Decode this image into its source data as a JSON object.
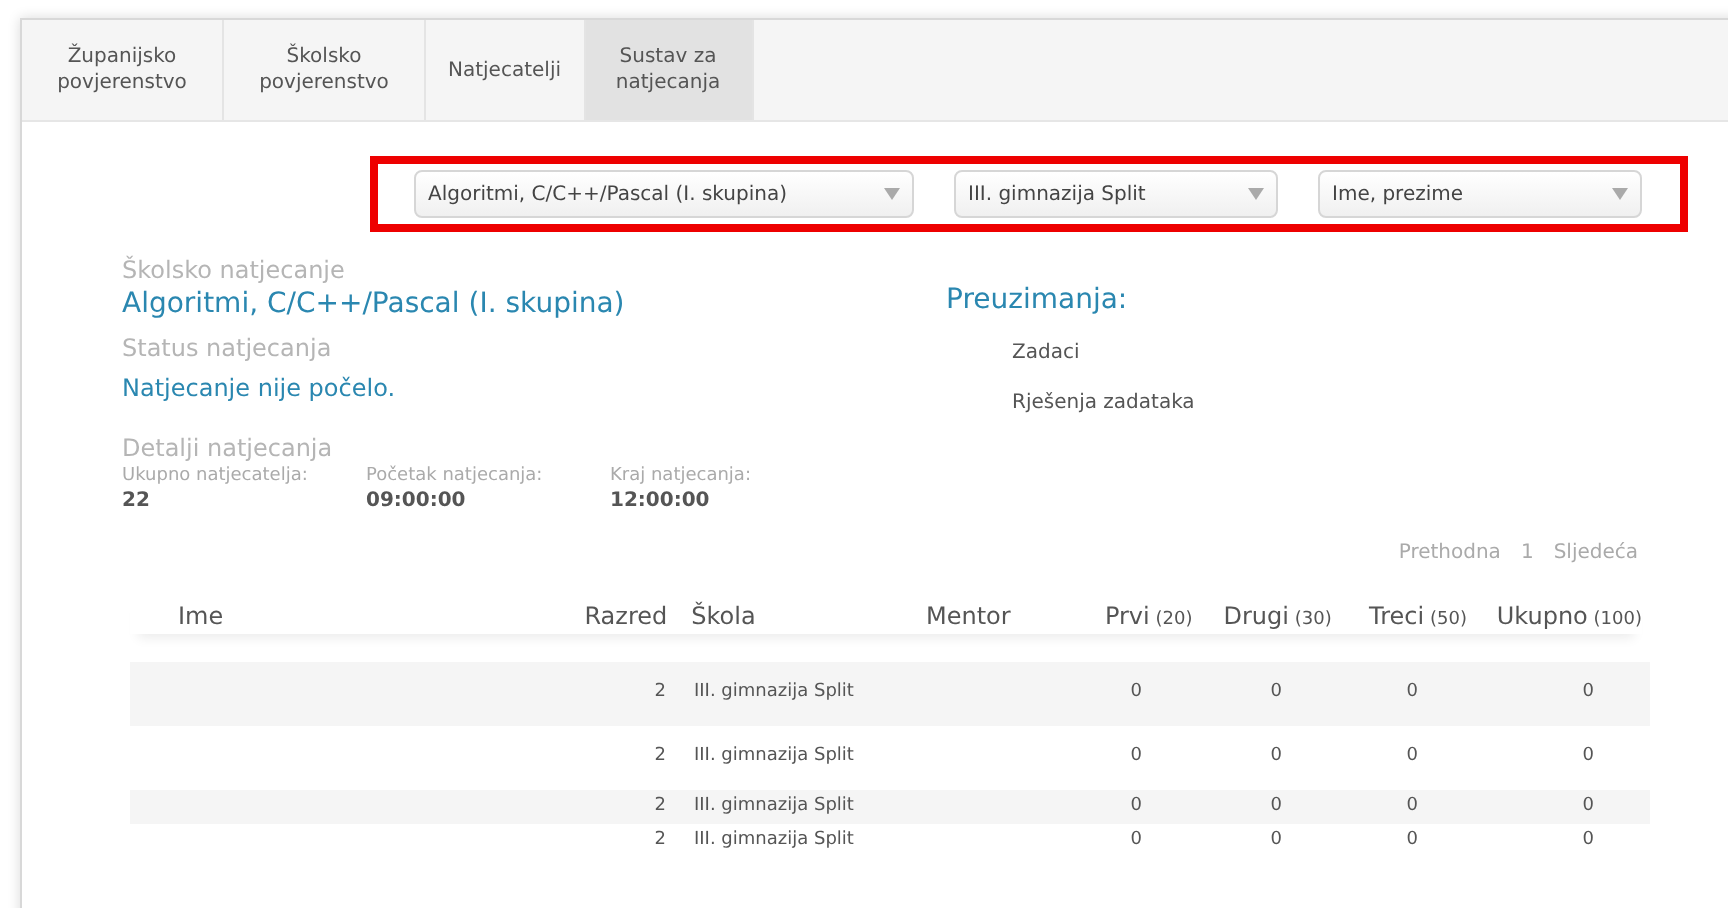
{
  "tabs": [
    {
      "label": "Županijsko povjerenstvo",
      "selected": false
    },
    {
      "label": "Školsko povjerenstvo",
      "selected": false
    },
    {
      "label": "Natjecatelji",
      "selected": false
    },
    {
      "label": "Sustav za natjecanja",
      "selected": true
    }
  ],
  "filters": [
    {
      "value": "Algoritmi, C/C++/Pascal (I. skupina)"
    },
    {
      "value": "III. gimnazija Split"
    },
    {
      "value": "Ime, prezime"
    }
  ],
  "competition": {
    "label": "Školsko natjecanje",
    "name": "Algoritmi, C/C++/Pascal (I. skupina)"
  },
  "status": {
    "label": "Status natjecanja",
    "value": "Natjecanje nije počelo."
  },
  "details": {
    "label": "Detalji natjecanja",
    "items": [
      {
        "label": "Ukupno natjecatelja:",
        "value": "22"
      },
      {
        "label": "Početak natjecanja:",
        "value": "09:00:00"
      },
      {
        "label": "Kraj natjecanja:",
        "value": "12:00:00"
      }
    ]
  },
  "downloads": {
    "title": "Preuzimanja:",
    "links": [
      "Zadaci",
      "Rješenja zadataka"
    ]
  },
  "pagination": {
    "prev": "Prethodna",
    "page": "1",
    "next": "Sljedeća"
  },
  "table": {
    "columns": [
      {
        "label": "Ime"
      },
      {
        "label": "Razred"
      },
      {
        "label": "Škola"
      },
      {
        "label": "Mentor"
      },
      {
        "label": "Prvi",
        "max": "(20)"
      },
      {
        "label": "Drugi",
        "max": "(30)"
      },
      {
        "label": "Treci",
        "max": "(50)"
      },
      {
        "label": "Ukupno",
        "max": "(100)"
      }
    ],
    "rows": [
      {
        "razred": "2",
        "skola": "III. gimnazija Split",
        "scores": [
          "0",
          "0",
          "0",
          "0"
        ]
      },
      {
        "razred": "2",
        "skola": "III. gimnazija Split",
        "scores": [
          "0",
          "0",
          "0",
          "0"
        ]
      },
      {
        "razred": "2",
        "skola": "III. gimnazija Split",
        "scores": [
          "0",
          "0",
          "0",
          "0"
        ]
      },
      {
        "razred": "2",
        "skola": "III. gimnazija Split",
        "scores": [
          "0",
          "0",
          "0",
          "0"
        ]
      }
    ]
  }
}
